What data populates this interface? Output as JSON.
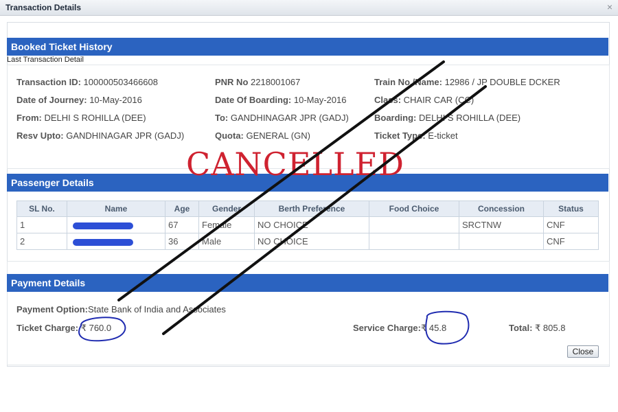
{
  "window": {
    "title": "Transaction Details",
    "close_glyph": "×"
  },
  "booked": {
    "header": "Booked Ticket History",
    "sub_label": "Last Transaction Detail",
    "fields": [
      {
        "label": "Transaction ID:",
        "value": "100000503466608"
      },
      {
        "label": "PNR No",
        "value": "2218001067"
      },
      {
        "label": "Train No./Name:",
        "value": "12986 / JP DOUBLE DCKER"
      },
      {
        "label": "Date of Journey:",
        "value": "10-May-2016"
      },
      {
        "label": "Date Of Boarding:",
        "value": "10-May-2016"
      },
      {
        "label": "Class:",
        "value": "CHAIR CAR (CC)"
      },
      {
        "label": "From:",
        "value": "DELHI S ROHILLA (DEE)"
      },
      {
        "label": "To:",
        "value": "GANDHINAGAR JPR (GADJ)"
      },
      {
        "label": "Boarding:",
        "value": "DELHI S ROHILLA (DEE)"
      },
      {
        "label": "Resv Upto:",
        "value": "GANDHINAGAR JPR (GADJ)"
      },
      {
        "label": "Quota:",
        "value": "GENERAL (GN)"
      },
      {
        "label": "Ticket Type:",
        "value": "E-ticket"
      }
    ]
  },
  "stamp": "CANCELLED",
  "passengers": {
    "header": "Passenger Details",
    "columns": [
      "SL No.",
      "Name",
      "Age",
      "Gender",
      "Berth Preference",
      "Food Choice",
      "Concession",
      "Status"
    ],
    "rows": [
      {
        "sl": "1",
        "age": "67",
        "gender": "Female",
        "berth": "NO CHOICE",
        "food": "",
        "concession": "SRCTNW",
        "status": "CNF"
      },
      {
        "sl": "2",
        "age": "36",
        "gender": "Male",
        "berth": "NO CHOICE",
        "food": "",
        "concession": "",
        "status": "CNF"
      }
    ]
  },
  "payment": {
    "header": "Payment Details",
    "option_label": "Payment Option:",
    "option_value": "State Bank of India and Associates",
    "ticket_charge_label": "Ticket Charge:",
    "ticket_charge_value": "₹ 760.0",
    "service_charge_label": "Service Charge:",
    "service_charge_value": "₹ 45.8",
    "total_label": "Total:",
    "total_value": "₹ 805.8"
  },
  "buttons": {
    "close": "Close"
  },
  "colors": {
    "header_bg": "#2b63c0",
    "stamp": "#cf2230",
    "annotation_ink": "#1f2bb0"
  }
}
